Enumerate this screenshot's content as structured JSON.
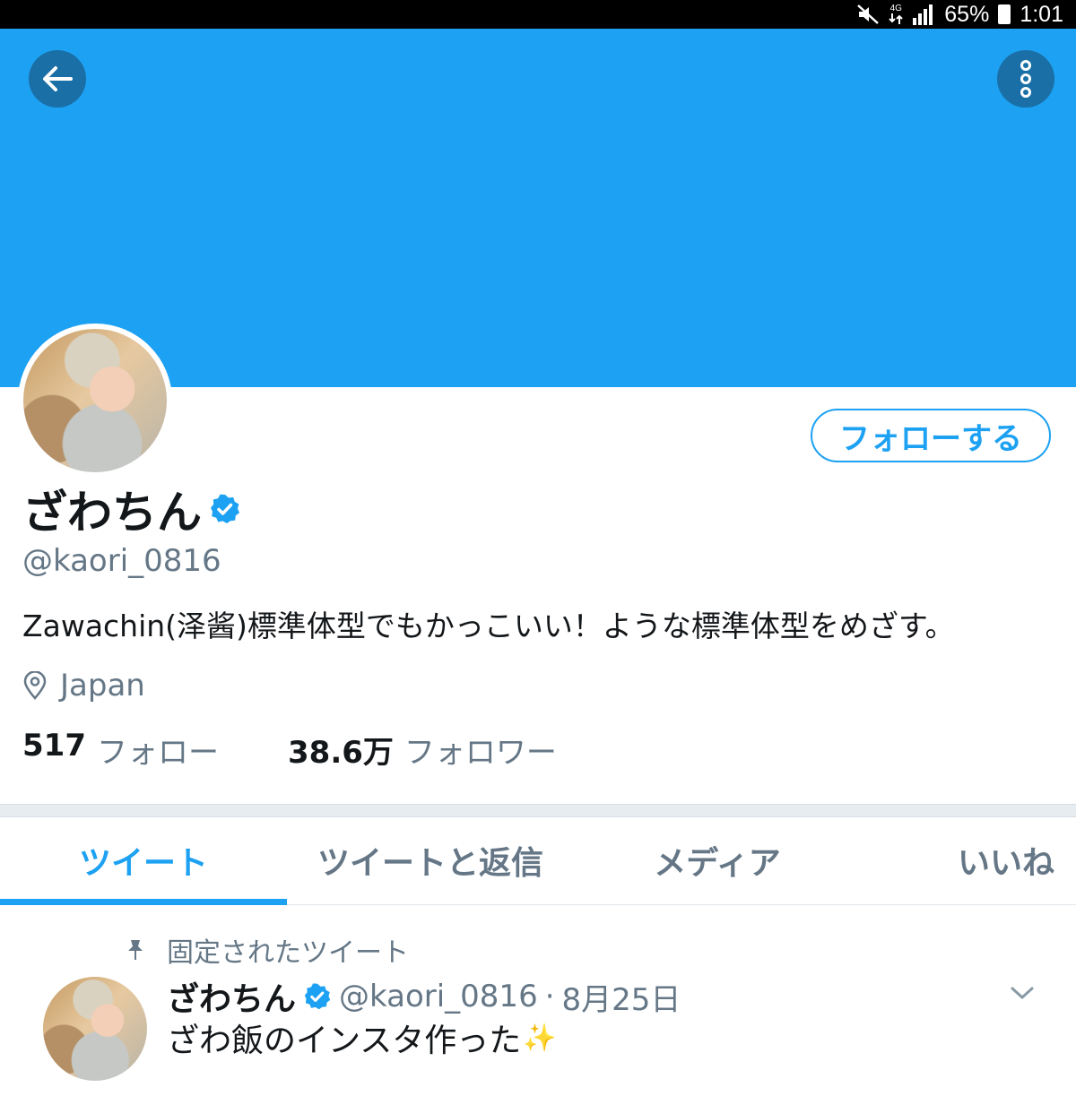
{
  "status_bar": {
    "network": "4G",
    "battery": "65%",
    "time": "1:01"
  },
  "header": {
    "banner_color": "#1da1f2",
    "back_icon": "arrow-left-icon",
    "more_icon": "more-vertical-icon"
  },
  "profile": {
    "display_name": "ざわちん",
    "verified": true,
    "handle": "@kaori_0816",
    "bio": "Zawachin(泽酱)標準体型でもかっこいい！ような標準体型をめざす。",
    "location": "Japan",
    "following_count": "517",
    "following_label": "フォロー",
    "followers_count": "38.6万",
    "followers_label": "フォロワー",
    "follow_button_label": "フォローする"
  },
  "tabs": [
    {
      "label": "ツイート",
      "active": true
    },
    {
      "label": "ツイートと返信",
      "active": false
    },
    {
      "label": "メディア",
      "active": false
    },
    {
      "label": "いいね",
      "active": false
    }
  ],
  "pinned_tweet": {
    "pinned_label": "固定されたツイート",
    "name": "ざわちん",
    "handle": "@kaori_0816",
    "separator": "·",
    "date": "8月25日",
    "text": "ざわ飯のインスタ作った",
    "emoji": "✨"
  },
  "colors": {
    "accent": "#1da1f2",
    "secondary_text": "#657786",
    "primary_text": "#14171a"
  }
}
